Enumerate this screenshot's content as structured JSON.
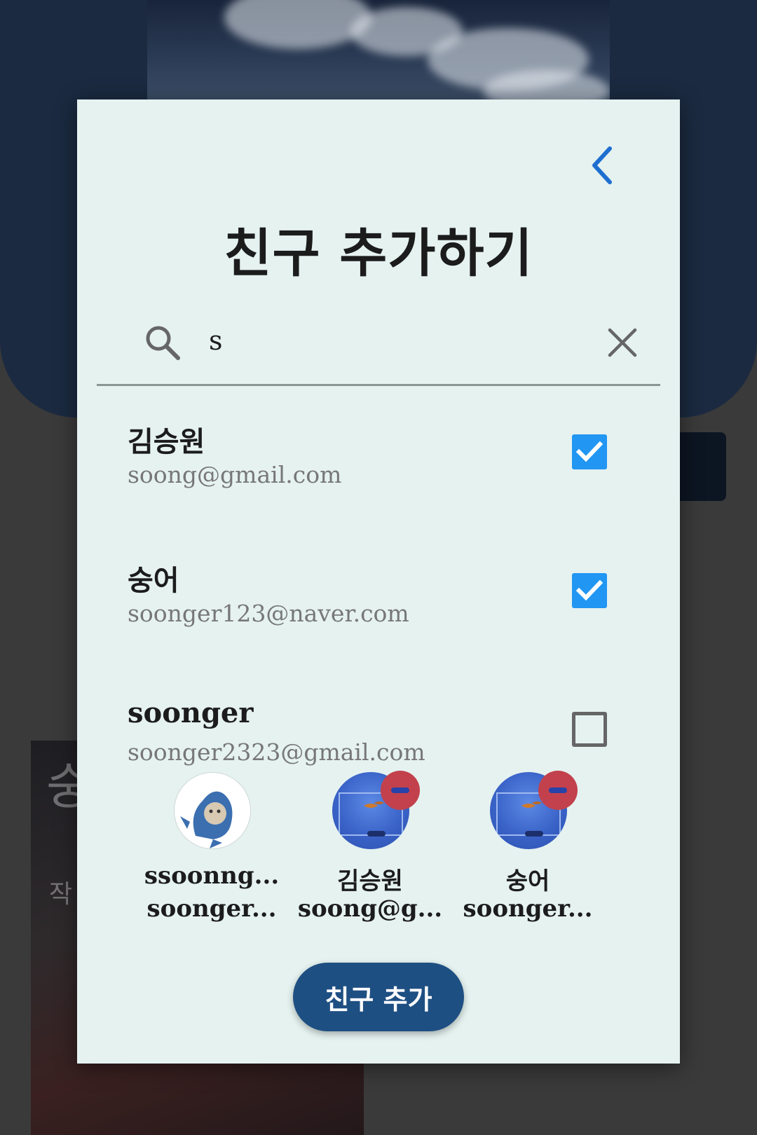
{
  "dialog": {
    "title": "친구 추가하기"
  },
  "search": {
    "value": "s"
  },
  "results": [
    {
      "name": "김승원",
      "email": "soong@gmail.com",
      "checked": true
    },
    {
      "name": "숭어",
      "email": "soonger123@naver.com",
      "checked": true
    },
    {
      "name": "soonger",
      "email": "soonger2323@gmail.com",
      "checked": false
    }
  ],
  "selected": [
    {
      "name": "ssoonng...",
      "email": "soonger...",
      "avatar": "shark-avatar",
      "removable": false
    },
    {
      "name": "김승원",
      "email": "soong@g...",
      "avatar": "fish-tank-avatar",
      "removable": true
    },
    {
      "name": "숭어",
      "email": "soonger...",
      "avatar": "fish-tank-avatar",
      "removable": true
    }
  ],
  "actions": {
    "add_label": "친구 추가"
  },
  "background": {
    "poster_glyph_1": "숭",
    "poster_glyph_2": "작"
  },
  "colors": {
    "accent": "#2196f3",
    "primary_button": "#1e4f82",
    "back_arrow": "#1e6fd0",
    "remove_badge": "#c2414c",
    "modal_bg": "#e5f2f0"
  }
}
